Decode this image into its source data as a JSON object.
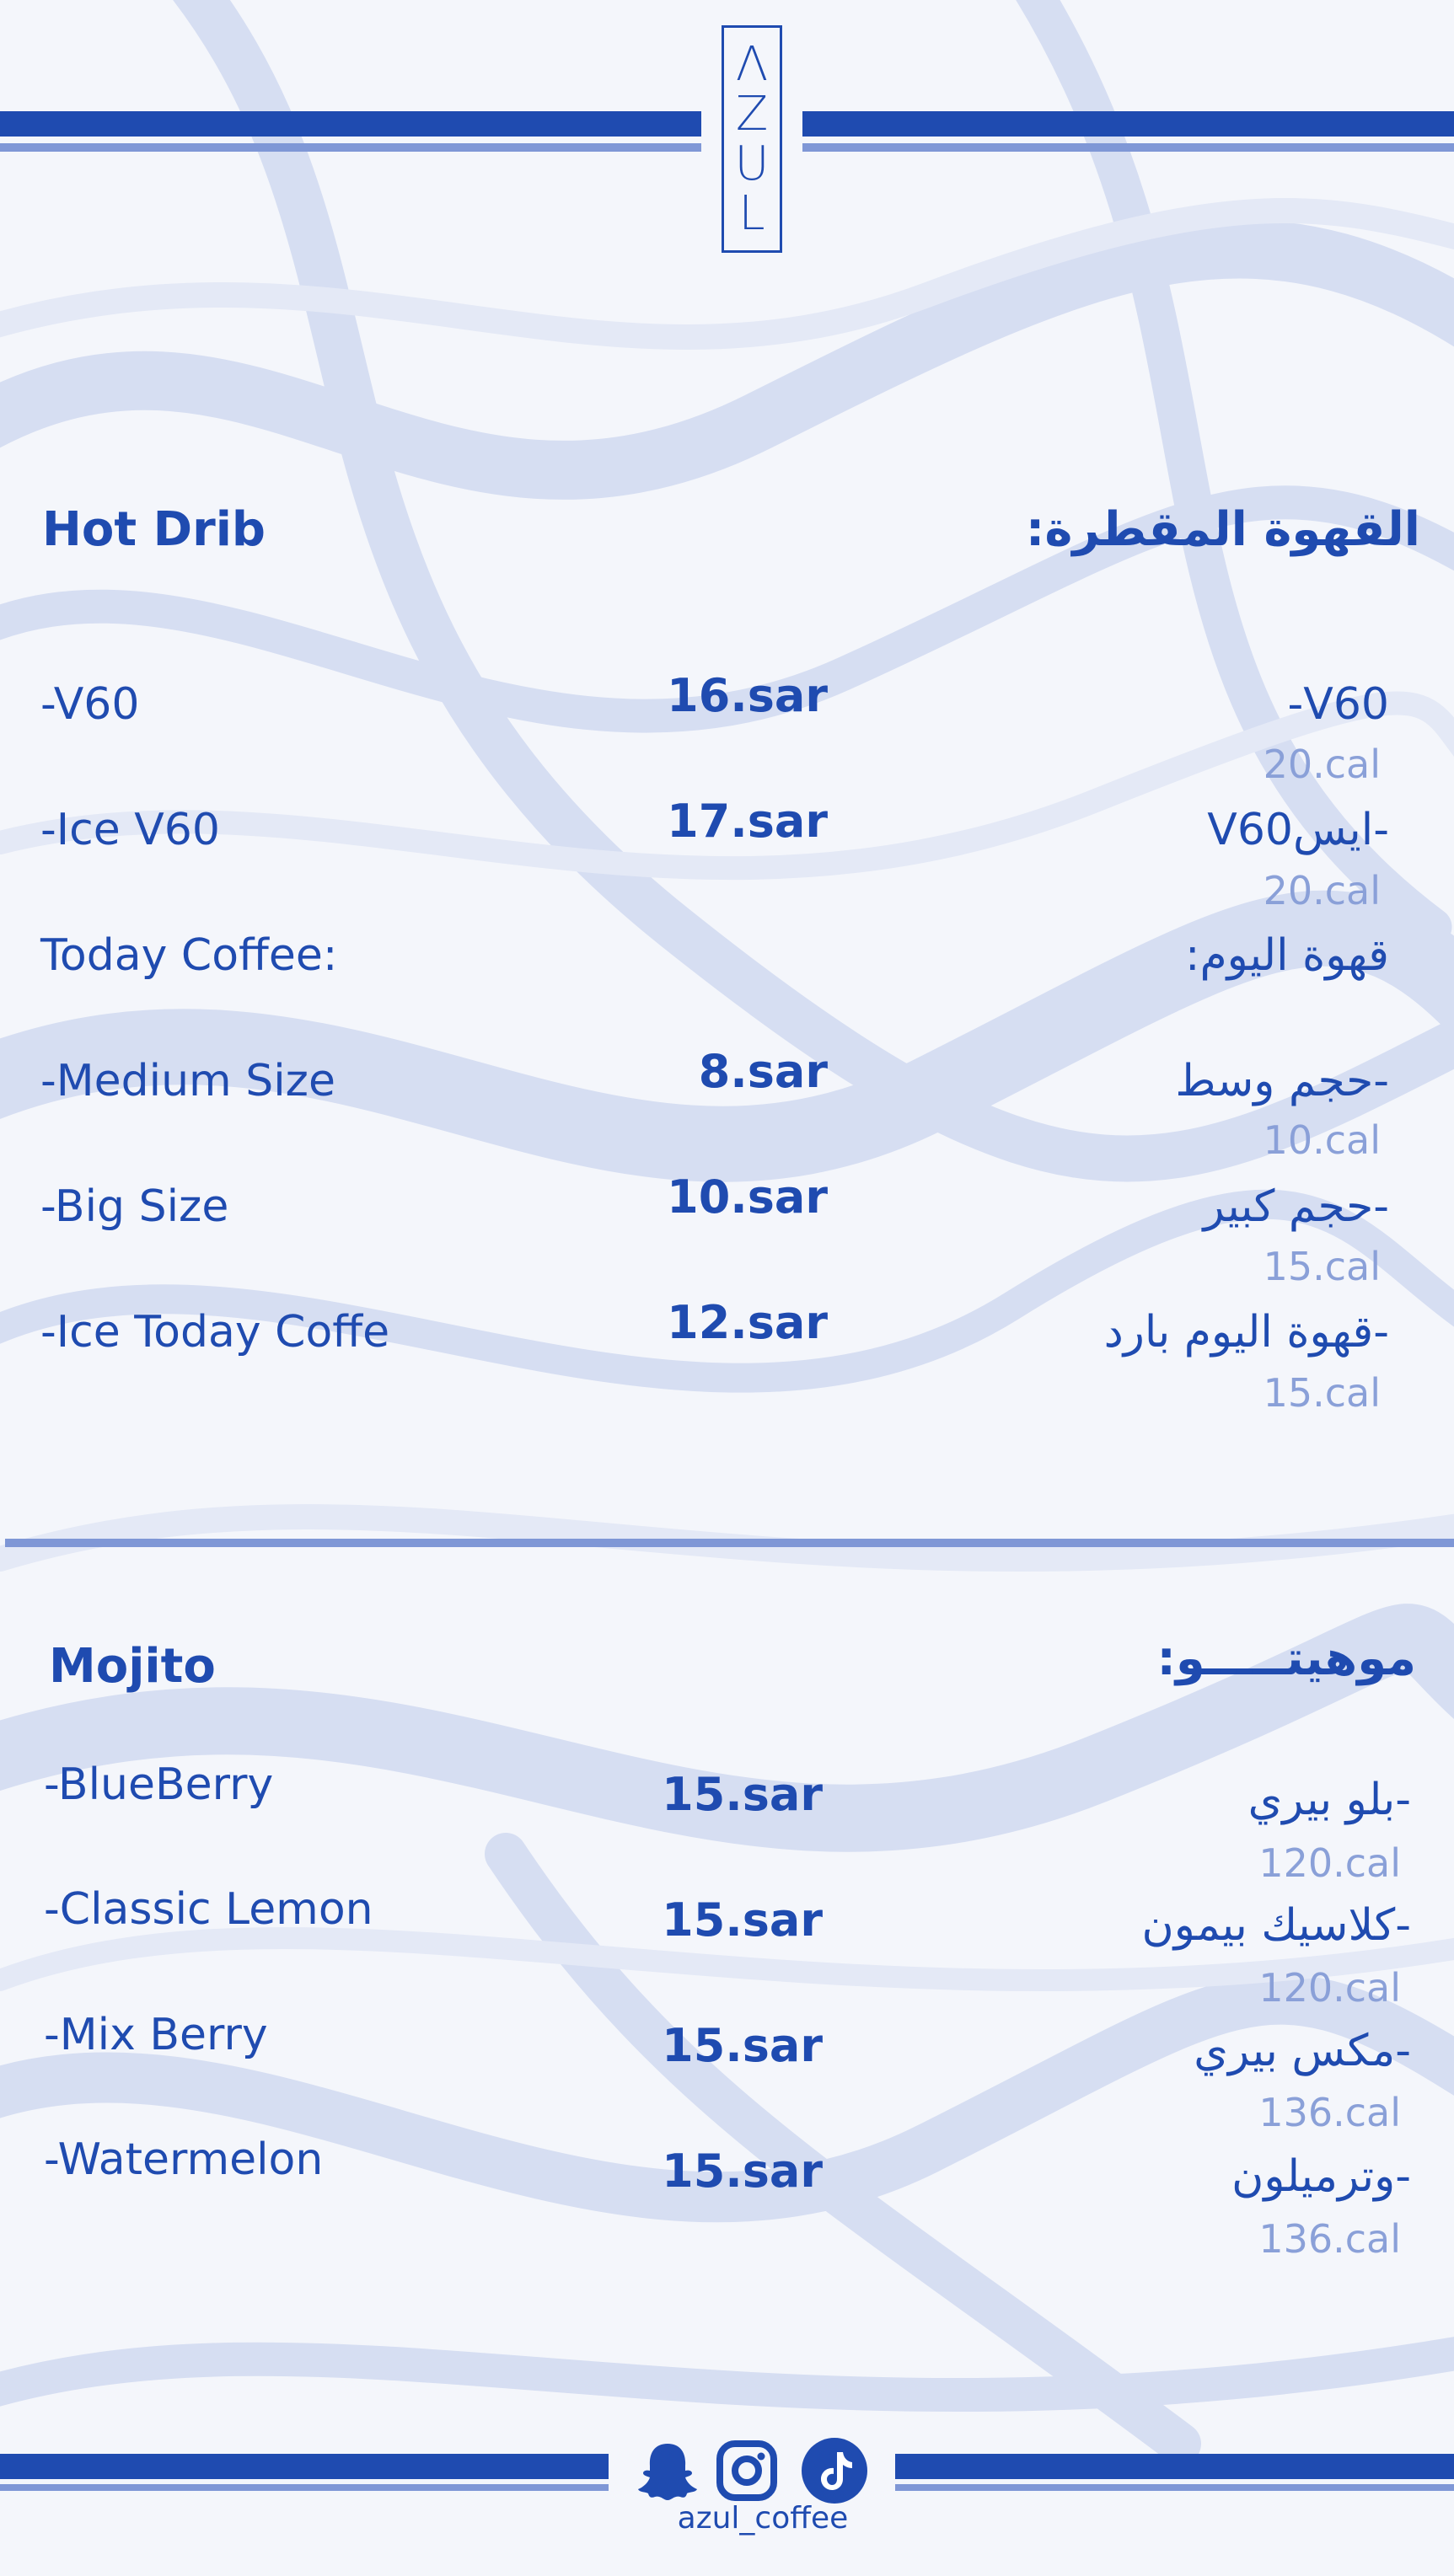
{
  "brand": {
    "logo_letters": [
      "Λ",
      "Z",
      "U",
      "L"
    ],
    "logo_text": "AZUL",
    "handle": "azul_coffee"
  },
  "colors": {
    "primary": "#1f4bb0",
    "secondary": "#7f97d6",
    "calories": "#8aa0d8",
    "background": "#f4f6fb"
  },
  "hot_drip": {
    "title_en": "Hot Drib",
    "title_ar": "القهوة المقطرة:",
    "items": [
      {
        "en": "-V60",
        "price": "16.sar",
        "ar": "V60-",
        "cal": "20.cal"
      },
      {
        "en": "-Ice V60",
        "price": "17.sar",
        "ar": "-ايسV60",
        "cal": "20.cal"
      },
      {
        "en": "Today Coffee:",
        "price": "",
        "ar": "قهوة اليوم:",
        "cal": ""
      },
      {
        "en": "-Medium Size",
        "price": "8.sar",
        "ar": "-حجم وسط",
        "cal": "10.cal"
      },
      {
        "en": "-Big Size",
        "price": "10.sar",
        "ar": "-حجم كبير",
        "cal": "15.cal"
      },
      {
        "en": "-Ice Today Coffe",
        "price": "12.sar",
        "ar": "-قهوة اليوم بارد",
        "cal": "15.cal"
      }
    ]
  },
  "mojito": {
    "title_en": "Mojito",
    "title_ar": "موهيتـــــو:",
    "items": [
      {
        "en": "-BlueBerry",
        "price": "15.sar",
        "ar": "-بلو بيري",
        "cal": "120.cal"
      },
      {
        "en": "-Classic Lemon",
        "price": "15.sar",
        "ar": "-كلاسيك بيمون",
        "cal": "120.cal"
      },
      {
        "en": "-Mix Berry",
        "price": "15.sar",
        "ar": "-مكس بيري",
        "cal": "136.cal"
      },
      {
        "en": "-Watermelon",
        "price": "15.sar",
        "ar": "-وترميلون",
        "cal": "136.cal"
      }
    ]
  },
  "social_icons": [
    "snapchat-icon",
    "instagram-icon",
    "tiktok-icon"
  ]
}
